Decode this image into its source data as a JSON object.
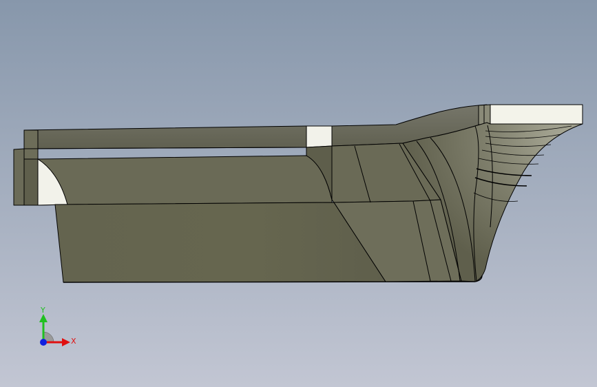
{
  "viewport": {
    "background_top": "#8797ab",
    "background_bottom": "#c2c6d3",
    "model": {
      "name": "hull",
      "shaded_color": "#63634f",
      "light_color": "#7a7a66",
      "edge_color": "#000000",
      "highlight_color": "#f2f2ea"
    }
  },
  "triad": {
    "x_label": "X",
    "y_label": "Y",
    "x_color": "#e01010",
    "y_color": "#20c020",
    "z_color": "#1020e0"
  }
}
